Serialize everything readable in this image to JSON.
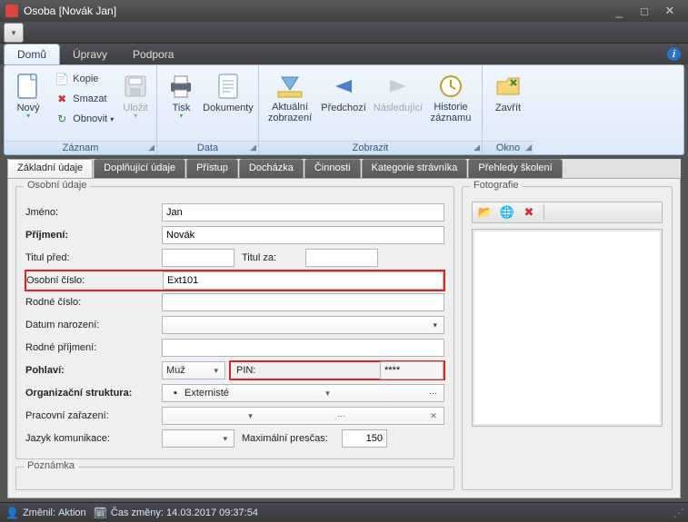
{
  "window": {
    "title": "Osoba [Novák Jan]"
  },
  "menus": {
    "home": "Domů",
    "edit": "Úpravy",
    "support": "Podpora"
  },
  "ribbon": {
    "new": "Nový",
    "copy": "Kopie",
    "delete": "Smazat",
    "refresh": "Obnovit",
    "save": "Uložit",
    "print": "Tisk",
    "documents": "Dokumenty",
    "current_view": "Aktuální\nzobrazení",
    "prev": "Předchozí",
    "next": "Následující",
    "history": "Historie\nzáznamu",
    "close": "Zavřít",
    "grp_record": "Záznam",
    "grp_data": "Data",
    "grp_view": "Zobrazit",
    "grp_window": "Okno"
  },
  "tabs": {
    "basic": "Základní údaje",
    "extra": "Doplňující údaje",
    "access": "Přístup",
    "attendance": "Docházka",
    "activities": "Činnosti",
    "diner": "Kategorie strávníka",
    "training": "Přehledy školení"
  },
  "form": {
    "section_personal": "Osobní údaje",
    "section_photo": "Fotografie",
    "section_note": "Poznámka",
    "firstname_lbl": "Jméno:",
    "firstname": "Jan",
    "lastname_lbl": "Příjmení:",
    "lastname": "Novák",
    "title_before_lbl": "Titul před:",
    "title_before": "",
    "title_after_lbl": "Titul za:",
    "title_after": "",
    "personal_no_lbl": "Osobní číslo:",
    "personal_no": "Ext101",
    "birth_no_lbl": "Rodné číslo:",
    "birth_no": "",
    "birth_date_lbl": "Datum narození:",
    "birth_date": "",
    "maiden_lbl": "Rodné příjmení:",
    "maiden": "",
    "gender_lbl": "Pohlaví:",
    "gender": "Muž",
    "pin_lbl": "PIN:",
    "pin": "****",
    "org_lbl": "Organizační struktura:",
    "org": "Externisté",
    "job_lbl": "Pracovní zařazení:",
    "job": "",
    "lang_lbl": "Jazyk komunikace:",
    "lang": "",
    "overtime_lbl": "Maximální presčas:",
    "overtime": "150"
  },
  "status": {
    "changed_by_lbl": "Změnil:",
    "changed_by": "Aktion",
    "changed_at_lbl": "Čas změny:",
    "changed_at": "14.03.2017 09:37:54"
  }
}
